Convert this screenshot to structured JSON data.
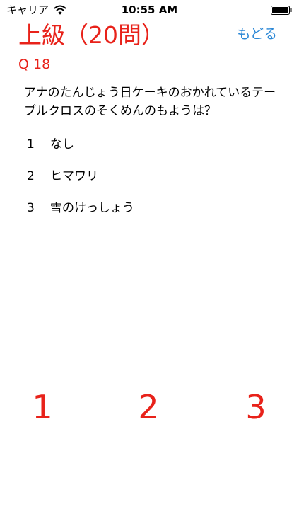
{
  "status_bar": {
    "carrier": "キャリア",
    "time": "10:55 AM",
    "icons": [
      "wifi-icon",
      "battery-icon"
    ]
  },
  "header": {
    "title": "上級（20問）",
    "back_label": "もどる"
  },
  "question": {
    "number_label": "Q 18",
    "text": "アナのたんじょう日ケーキのおかれているテーブルクロスのそくめんのもようは？"
  },
  "options": [
    {
      "num": "1",
      "label": "なし"
    },
    {
      "num": "2",
      "label": "ヒマワリ"
    },
    {
      "num": "3",
      "label": "雪のけっしょう"
    }
  ],
  "answer_buttons": [
    "1",
    "2",
    "3"
  ],
  "colors": {
    "accent_red": "#e8221a",
    "link_blue": "#2a87d6",
    "text": "#000000",
    "background": "#ffffff"
  }
}
